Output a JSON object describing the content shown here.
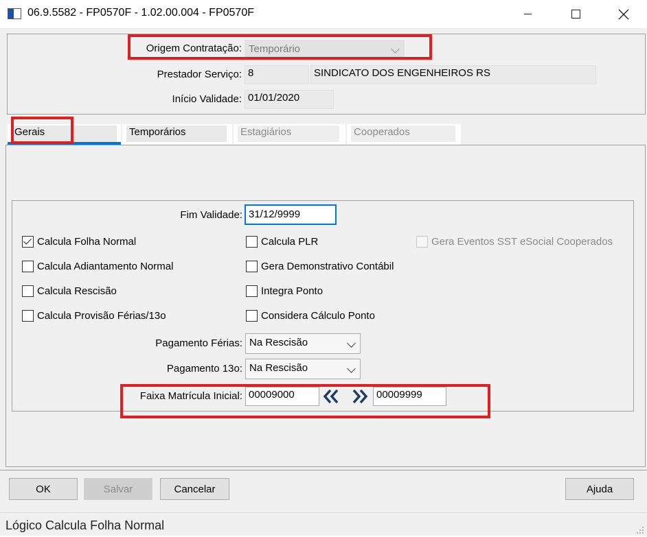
{
  "window": {
    "title": "06.9.5582 - FP0570F - 1.02.00.004 - FP0570F"
  },
  "header": {
    "origem_label": "Origem Contratação:",
    "origem_value": "Temporário",
    "prestador_label": "Prestador Serviço:",
    "prestador_code": "8",
    "prestador_name": "SINDICATO DOS ENGENHEIROS RS",
    "inicio_label": "Início Validade:",
    "inicio_value": "01/01/2020"
  },
  "tabs": [
    {
      "label": "Gerais",
      "selected": true,
      "enabled": true
    },
    {
      "label": "Temporários",
      "selected": false,
      "enabled": true
    },
    {
      "label": "Estagiários",
      "selected": false,
      "enabled": false
    },
    {
      "label": "Cooperados",
      "selected": false,
      "enabled": false
    }
  ],
  "gerais": {
    "fim_label": "Fim Validade:",
    "fim_value": "31/12/9999",
    "checkboxes": [
      {
        "label": "Calcula Folha Normal",
        "checked": true,
        "enabled": true
      },
      {
        "label": "Calcula Adiantamento Normal",
        "checked": false,
        "enabled": true
      },
      {
        "label": "Calcula Rescisão",
        "checked": false,
        "enabled": true
      },
      {
        "label": "Calcula Provisão Férias/13o",
        "checked": false,
        "enabled": true
      },
      {
        "label": "Calcula PLR",
        "checked": false,
        "enabled": true
      },
      {
        "label": "Gera Demonstrativo Contábil",
        "checked": false,
        "enabled": true
      },
      {
        "label": "Integra Ponto",
        "checked": false,
        "enabled": true
      },
      {
        "label": "Considera Cálculo Ponto",
        "checked": false,
        "enabled": true
      },
      {
        "label": "Gera Eventos SST eSocial Cooperados",
        "checked": false,
        "enabled": false
      }
    ],
    "pag_ferias_label": "Pagamento Férias:",
    "pag_ferias_value": "Na Rescisão",
    "pag_13_label": "Pagamento 13o:",
    "pag_13_value": "Na Rescisão",
    "faixa_label": "Faixa Matrícula Inicial:",
    "faixa_inicial": "00009000",
    "faixa_final": "00009999"
  },
  "buttons": {
    "ok": "OK",
    "salvar": "Salvar",
    "cancelar": "Cancelar",
    "ajuda": "Ajuda"
  },
  "status": {
    "text": "Lógico Calcula Folha Normal"
  },
  "colors": {
    "highlight": "#e02020",
    "accent": "#0078d7"
  }
}
